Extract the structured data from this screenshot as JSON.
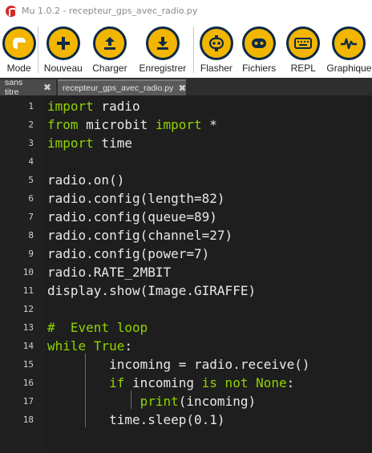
{
  "window": {
    "title": "Mu 1.0.2 - recepteur_gps_avec_radio.py"
  },
  "toolbar": {
    "buttons": [
      {
        "label": "Mode",
        "icon": "mode-icon"
      },
      {
        "label": "Nouveau",
        "icon": "plus-icon"
      },
      {
        "label": "Charger",
        "icon": "upload-icon"
      },
      {
        "label": "Enregistrer",
        "icon": "download-icon"
      },
      {
        "label": "Flasher",
        "icon": "microbit-icon"
      },
      {
        "label": "Fichiers",
        "icon": "files-icon"
      },
      {
        "label": "REPL",
        "icon": "keyboard-icon"
      },
      {
        "label": "Graphique",
        "icon": "pulse-icon"
      }
    ]
  },
  "tabs": [
    {
      "label": "sans titre",
      "close": "✖"
    },
    {
      "label": "recepteur_gps_avec_radio.py",
      "close": "✖"
    }
  ],
  "colors": {
    "accent": "#f2b500",
    "toolbar_dark": "#0d2a46",
    "keyword": "#8fd400",
    "editor_bg": "#1e1e1e"
  },
  "editor": {
    "lines": [
      {
        "n": "1",
        "tokens": [
          {
            "t": "import",
            "c": "kw"
          },
          {
            "t": " radio",
            "c": ""
          }
        ]
      },
      {
        "n": "2",
        "tokens": [
          {
            "t": "from",
            "c": "kw"
          },
          {
            "t": " microbit ",
            "c": ""
          },
          {
            "t": "import",
            "c": "kw"
          },
          {
            "t": " *",
            "c": ""
          }
        ]
      },
      {
        "n": "3",
        "tokens": [
          {
            "t": "import",
            "c": "kw"
          },
          {
            "t": " time",
            "c": ""
          }
        ]
      },
      {
        "n": "4",
        "tokens": []
      },
      {
        "n": "5",
        "tokens": [
          {
            "t": "radio.on()",
            "c": ""
          }
        ]
      },
      {
        "n": "6",
        "tokens": [
          {
            "t": "radio.config(length=82)",
            "c": ""
          }
        ]
      },
      {
        "n": "7",
        "tokens": [
          {
            "t": "radio.config(queue=89)",
            "c": ""
          }
        ]
      },
      {
        "n": "8",
        "tokens": [
          {
            "t": "radio.config(channel=27)",
            "c": ""
          }
        ]
      },
      {
        "n": "9",
        "tokens": [
          {
            "t": "radio.config(power=7)",
            "c": ""
          }
        ]
      },
      {
        "n": "10",
        "tokens": [
          {
            "t": "radio.RATE_2MBIT",
            "c": ""
          }
        ]
      },
      {
        "n": "11",
        "tokens": [
          {
            "t": "display.show(Image.GIRAFFE)",
            "c": ""
          }
        ]
      },
      {
        "n": "12",
        "tokens": []
      },
      {
        "n": "13",
        "tokens": [
          {
            "t": "#  Event loop",
            "c": "cm"
          }
        ]
      },
      {
        "n": "14",
        "tokens": [
          {
            "t": "while",
            "c": "kw"
          },
          {
            "t": " ",
            "c": ""
          },
          {
            "t": "True",
            "c": "kw"
          },
          {
            "t": ":",
            "c": ""
          }
        ]
      },
      {
        "n": "15",
        "tokens": [
          {
            "t": "        incoming = radio.receive()",
            "c": ""
          }
        ]
      },
      {
        "n": "16",
        "tokens": [
          {
            "t": "        ",
            "c": ""
          },
          {
            "t": "if",
            "c": "kw"
          },
          {
            "t": " incoming ",
            "c": ""
          },
          {
            "t": "is not",
            "c": "kw"
          },
          {
            "t": " ",
            "c": ""
          },
          {
            "t": "None",
            "c": "kw"
          },
          {
            "t": ":",
            "c": ""
          }
        ]
      },
      {
        "n": "17",
        "tokens": [
          {
            "t": "            ",
            "c": ""
          },
          {
            "t": "print",
            "c": "kw"
          },
          {
            "t": "(incoming)",
            "c": ""
          }
        ]
      },
      {
        "n": "18",
        "tokens": [
          {
            "t": "        time.sleep(0.1)",
            "c": ""
          }
        ]
      }
    ]
  }
}
